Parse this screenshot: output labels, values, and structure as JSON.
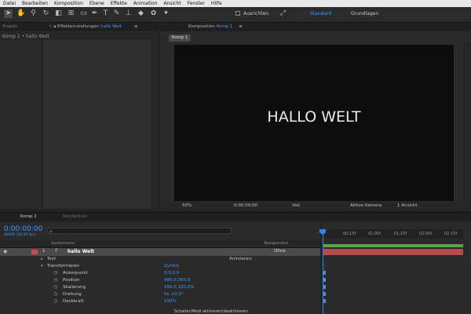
{
  "menubar": [
    "Datei",
    "Bearbeiten",
    "Komposition",
    "Ebene",
    "Effekte",
    "Animation",
    "Ansicht",
    "Fenster",
    "Hilfe"
  ],
  "toolbar": {
    "ausrichten": "Ausrichten",
    "workspace_active": "Standard",
    "workspace_other": "Grundlagen"
  },
  "left_panel": {
    "tab_project": "Projekt",
    "tab_effects_prefix": "Effekteinstellungen",
    "tab_effects_layer": "hallo Welt",
    "breadcrumb": "Komp 1 • hallo Welt"
  },
  "comp_panel": {
    "tab_prefix": "Komposition",
    "tab_name": "Komp 1",
    "comp_button": "Komp 1",
    "viewer_text": "HALLO WELT",
    "footer": {
      "zoom": "50%",
      "timecode": "0:00:00:00",
      "resolution": "Voll",
      "camera": "Aktive Kamera",
      "views": "1 Ansicht"
    }
  },
  "timeline": {
    "tab_comp": "Komp 1",
    "tab_render": "Renderliste",
    "timecode": "0:00:00:00",
    "fps": "00000 (30.00 fps)",
    "search_placeholder": "ρ.",
    "col_source": "Quellenname",
    "col_parent": "Übergeordnet",
    "ruler": [
      "00:15f",
      "01:00f",
      "01:15f",
      "02:00f",
      "02:15f"
    ],
    "layer": {
      "number": "1",
      "name": "hallo Welt",
      "parent": "Ohne"
    },
    "rows": {
      "text": "Text",
      "animieren": "Animieren:",
      "transform": "Transformieren",
      "zuruck": "Zurück",
      "ankerpunkt": "Ankerpunkt",
      "ankerpunkt_val": "0,0,0,0",
      "position": "Position",
      "position_val": "480,0,360,0",
      "skalierung": "Skalierung",
      "skalierung_val": "100,0,100,0%",
      "drehung": "Drehung",
      "drehung_val": "0x +0,0°",
      "deckkraft": "Deckkraft",
      "deckkraft_val": "100%"
    },
    "status": "Schalter/Modi aktivieren/deaktivieren"
  }
}
